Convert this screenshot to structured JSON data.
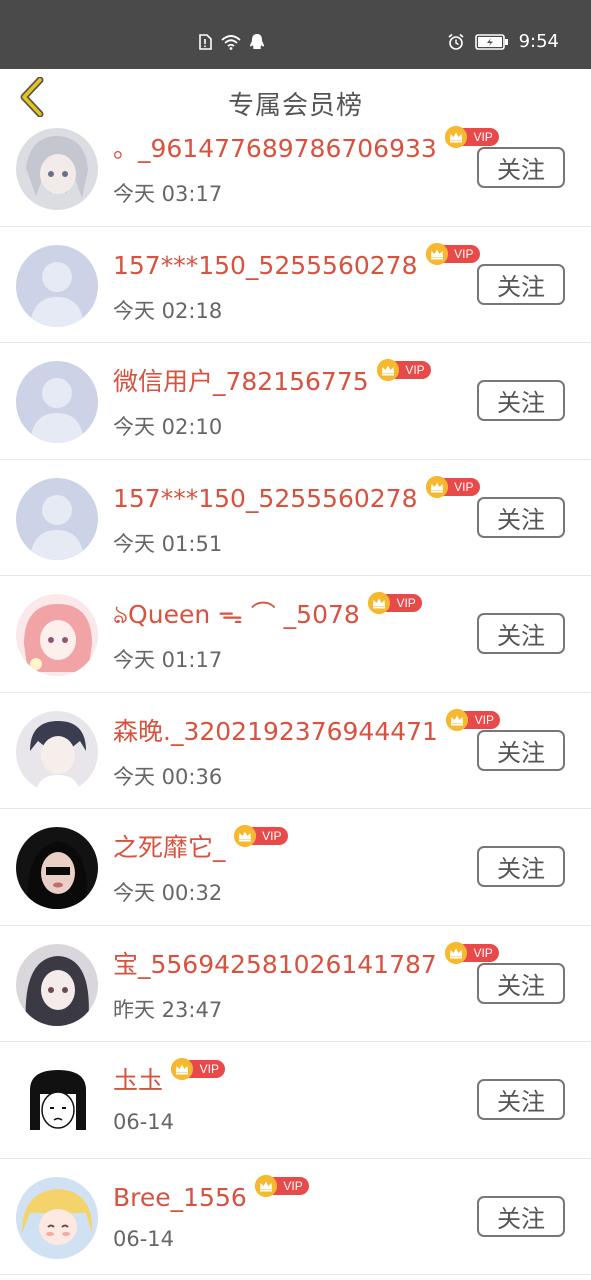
{
  "status_bar": {
    "time": "9:54",
    "icons": [
      "sim-icon",
      "wifi-icon",
      "qq-icon",
      "alarm-icon",
      "battery-icon"
    ]
  },
  "header": {
    "title": "专属会员榜",
    "back_icon": "chevron-left-icon",
    "accent_color": "#e6c419"
  },
  "colors": {
    "name": "#d8523f",
    "vip_badge": "#e84a4a",
    "vip_crown": "#f5b82e"
  },
  "vip_label": "VIP",
  "follow_label": "关注",
  "members": [
    {
      "name": "。_961477689786706933",
      "time": "今天 03:17",
      "avatar": "anime-silver-hair"
    },
    {
      "name": "157***150_5255560278",
      "time": "今天 02:18",
      "avatar": "default-person"
    },
    {
      "name": "微信用户_782156775",
      "time": "今天 02:10",
      "avatar": "default-person"
    },
    {
      "name": "157***150_5255560278",
      "time": "今天 01:51",
      "avatar": "default-person"
    },
    {
      "name": "ঌQueen ᯓ ⌒ _5078",
      "time": "今天 01:17",
      "avatar": "anime-pink-hair"
    },
    {
      "name": "森晚._3202192376944471",
      "time": "今天 00:36",
      "avatar": "anime-boy"
    },
    {
      "name": "之死靡它_",
      "time": "今天 00:32",
      "avatar": "photo-girl"
    },
    {
      "name": "宝_556942581026141787",
      "time": "昨天 23:47",
      "avatar": "anime-dark-hair"
    },
    {
      "name": "圡圡",
      "time": "06-14",
      "avatar": "manga-girl"
    },
    {
      "name": "Bree_1556",
      "time": "06-14",
      "avatar": "anime-blonde"
    }
  ]
}
